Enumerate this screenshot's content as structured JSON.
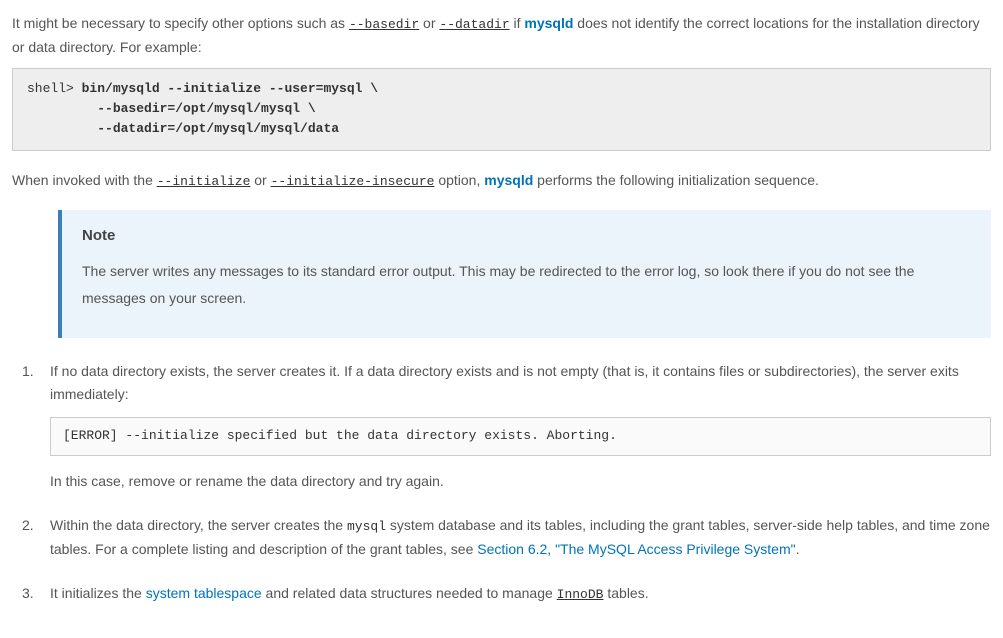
{
  "intro": {
    "p1a": "It might be necessary to specify other options such as ",
    "opt_basedir": "--basedir",
    "p1b": " or ",
    "opt_datadir": "--datadir",
    "p1c": " if ",
    "mysqld": "mysqld",
    "p1d": " does not identify the correct locations for the installation directory or data directory. For example:"
  },
  "codeblock1": {
    "prompt": "shell> ",
    "line1": "bin/mysqld --initialize --user=mysql \\",
    "line2": "         --basedir=/opt/mysql/mysql \\",
    "line3": "         --datadir=/opt/mysql/mysql/data"
  },
  "after_code": {
    "a": "When invoked with the ",
    "opt_init": "--initialize",
    "b": " or ",
    "opt_init_insecure": "--initialize-insecure",
    "c": " option, ",
    "mysqld": "mysqld",
    "d": " performs the following initialization sequence."
  },
  "note": {
    "title": "Note",
    "body": "The server writes any messages to its standard error output. This may be redirected to the error log, so look there if you do not see the messages on your screen."
  },
  "steps": {
    "s1": {
      "num": "1.",
      "p1": "If no data directory exists, the server creates it. If a data directory exists and is not empty (that is, it contains files or subdirectories), the server exits immediately:",
      "code": "[ERROR] --initialize specified but the data directory exists. Aborting.",
      "p2": "In this case, remove or rename the data directory and try again."
    },
    "s2": {
      "num": "2.",
      "a": "Within the data directory, the server creates the ",
      "mysql": "mysql",
      "b": " system database and its tables, including the grant tables, server-side help tables, and time zone tables. For a complete listing and description of the grant tables, see ",
      "link": "Section 6.2, \"The MySQL Access Privilege System\"",
      "c": "."
    },
    "s3": {
      "num": "3.",
      "a": "It initializes the ",
      "link": "system tablespace",
      "b": " and related data structures needed to manage ",
      "innodb": "InnoDB",
      "c": " tables."
    }
  }
}
